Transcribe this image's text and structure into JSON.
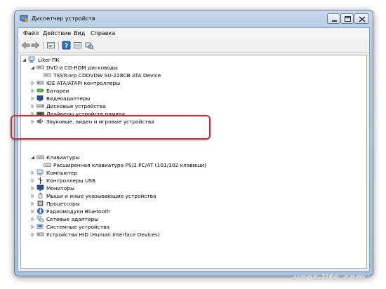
{
  "window": {
    "title": "Диспетчер устройств"
  },
  "menu": [
    {
      "label": "Файл"
    },
    {
      "label": "Действие"
    },
    {
      "label": "Вид"
    },
    {
      "label": "Справка"
    }
  ],
  "toolbar": [
    "back-arrow-icon",
    "forward-arrow-icon",
    "properties-icon",
    "help-icon",
    "update-driver-icon",
    "scan-hardware-icon"
  ],
  "tree": {
    "root": "Liker-ПК",
    "items": [
      {
        "label": "DVD и CD-ROM дисководы",
        "expanded": true,
        "icon": "dvd-drive-icon"
      },
      {
        "label": "TSSTcorp CDDVDW SU-228CB ATA Device",
        "child": true,
        "icon": "dvd-device-icon"
      },
      {
        "label": "IDE ATA/ATAPI контроллеры",
        "icon": "ide-controller-icon"
      },
      {
        "label": "Батареи",
        "icon": "battery-icon"
      },
      {
        "label": "Видеоадаптеры",
        "icon": "display-adapter-icon"
      },
      {
        "label": "Дисковые устройства",
        "icon": "disk-drive-icon"
      },
      {
        "label": "Драйверы устройств памяти",
        "icon": "memory-driver-icon"
      },
      {
        "label": "Звуковые, видео и игровые устройства",
        "icon": "sound-icon"
      },
      {
        "label": "Клавиатуры",
        "expanded": true,
        "icon": "keyboard-icon"
      },
      {
        "label": "Расширенная клавиатура PS/2 PC/AT (101/102 клавиши)",
        "child": true,
        "icon": "keyboard-device-icon"
      },
      {
        "label": "Компьютер",
        "icon": "computer-icon"
      },
      {
        "label": "Контроллеры USB",
        "icon": "usb-icon"
      },
      {
        "label": "Мониторы",
        "icon": "monitor-icon"
      },
      {
        "label": "Мыши и иные указывающие устройства",
        "icon": "mouse-icon"
      },
      {
        "label": "Процессоры",
        "icon": "processor-icon"
      },
      {
        "label": "Радиомодули Bluetooth",
        "icon": "bluetooth-icon"
      },
      {
        "label": "Сетевые адаптеры",
        "icon": "network-icon"
      },
      {
        "label": "Системные устройства",
        "icon": "system-icon"
      },
      {
        "label": "Устройства HID (Human Interface Devices)",
        "icon": "hid-icon"
      }
    ]
  },
  "watermark": "user-life.com",
  "colors": {
    "highlight": "#c1313f",
    "window_frame": "#b9cde5"
  }
}
